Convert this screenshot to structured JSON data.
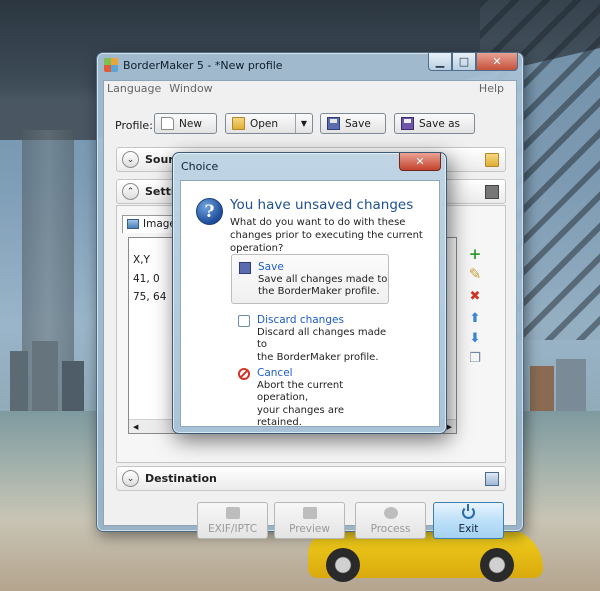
{
  "window": {
    "title": "BorderMaker 5 - *New profile",
    "controls": {
      "minimize": "▁",
      "maximize": "□",
      "close": "✕"
    }
  },
  "menu": {
    "language": "Language",
    "window": "Window",
    "help": "Help"
  },
  "profile": {
    "label": "Profile:",
    "new_label": "New",
    "open_label": "Open",
    "open_dropdown": "▼",
    "save_label": "Save",
    "save_as_label": "Save as"
  },
  "panels": {
    "source": {
      "title": "Sour",
      "chevron": "⌄"
    },
    "settings": {
      "title": "Setti",
      "chevron": "⌃"
    },
    "destination": {
      "title": "Destination",
      "chevron": "⌄"
    }
  },
  "settings_tab": {
    "label": "Image"
  },
  "list": {
    "header": "X,Y",
    "rows": [
      "41, 0",
      "75, 64"
    ],
    "scroll_left": "◀",
    "scroll_right": "▶"
  },
  "side_tools": {
    "add": "+",
    "edit": "✎",
    "delete": "✖",
    "up": "⬆",
    "down": "⬇",
    "copy": "❐"
  },
  "footer": {
    "exif_label": "EXIF/IPTC",
    "preview_label": "Preview",
    "process_label": "Process",
    "exit_label": "Exit"
  },
  "dialog": {
    "title": "Choice",
    "close": "✕",
    "question_mark": "?",
    "heading": "You have unsaved changes",
    "message": "What do you want to do with these changes prior to executing the current operation?",
    "options": [
      {
        "title": "Save",
        "line1": "Save all changes made to",
        "line2": "the BorderMaker profile."
      },
      {
        "title": "Discard changes",
        "line1": "Discard all changes made to",
        "line2": "the BorderMaker profile."
      },
      {
        "title": "Cancel",
        "line1": "Abort the current operation,",
        "line2": "your changes are retained."
      }
    ]
  },
  "colors": {
    "accent_blue": "#1d4f91",
    "link_blue": "#1d5cc4",
    "close_red": "#c3432d",
    "add_green": "#2f9a2f",
    "delete_red": "#d13526"
  }
}
